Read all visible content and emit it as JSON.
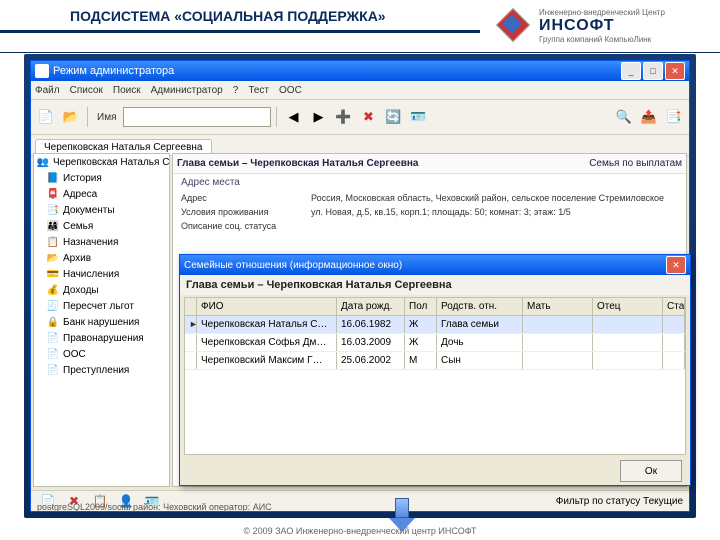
{
  "slide_title": "ПОДСИСТЕМА «СОЦИАЛЬНАЯ ПОДДЕРЖКА»",
  "logo": {
    "over": "Инженерно-внедренческий Центр",
    "name": "ИНСОФТ",
    "sub": "Группа компаний КомпьюЛинк"
  },
  "footer": "© 2009 ЗАО Инженерно-внедренческий центр ИНСОФТ",
  "app": {
    "title": "Режим администратора",
    "menus": [
      "Файл",
      "Список",
      "Поиск",
      "Администратор",
      "?",
      "Тест",
      "ООС"
    ],
    "toolbar_label_name": "Имя",
    "search_placeholder": "",
    "tab": "Черепковская Наталья Сергеевна",
    "tree": [
      {
        "ico": "👥",
        "lbl": "Черепковская Наталья Сергеевна",
        "lvl": 0
      },
      {
        "ico": "📘",
        "lbl": "История",
        "lvl": 1
      },
      {
        "ico": "📮",
        "lbl": "Адреса",
        "lvl": 1
      },
      {
        "ico": "📑",
        "lbl": "Документы",
        "lvl": 1
      },
      {
        "ico": "👨‍👩‍👧",
        "lbl": "Семья",
        "lvl": 1
      },
      {
        "ico": "📋",
        "lbl": "Назначения",
        "lvl": 1
      },
      {
        "ico": "📂",
        "lbl": "Архив",
        "lvl": 1
      },
      {
        "ico": "💳",
        "lbl": "Начисления",
        "lvl": 1
      },
      {
        "ico": "💰",
        "lbl": "Доходы",
        "lvl": 1
      },
      {
        "ico": "🧾",
        "lbl": "Пересчет льгот",
        "lvl": 1
      },
      {
        "ico": "🔒",
        "lbl": "Банк нарушения",
        "lvl": 1
      },
      {
        "ico": "📄",
        "lbl": "Правонарушения",
        "lvl": 1
      },
      {
        "ico": "📄",
        "lbl": "ООС",
        "lbl2": "",
        "lvl": 1
      },
      {
        "ico": "📄",
        "lbl": "Преступления",
        "lvl": 1
      }
    ],
    "content": {
      "heading_l": "Глава семьи – Черепковская Наталья Сергеевна",
      "heading_r": "Семья по выплатам",
      "sub": "Адрес места",
      "rows": [
        {
          "l": "Адрес",
          "r": "Россия, Московская область, Чеховский район, сельское поселение Стремиловское"
        },
        {
          "l": "Условия проживания",
          "r": "ул. Новая, д.5, кв.15, корп.1; площадь: 50; комнат: 3; этаж: 1/5"
        },
        {
          "l": "Описание соц. статуса",
          "r": ""
        }
      ]
    },
    "statusbar_left": "postgreSQL2009/social   район: Чеховский   оператор: АИС",
    "statusbar_right": "Фильтр по статусу   Текущие"
  },
  "modal": {
    "title": "Семейные отношения (информационное окно)",
    "heading": "Глава семьи – Черепковская Наталья Сергеевна",
    "columns": [
      "",
      "ФИО",
      "Дата рожд.",
      "Пол",
      "Родств. отн.",
      "Мать",
      "Отец",
      "Статус"
    ],
    "rows": [
      {
        "mark": "►",
        "fio": "Черепковская Наталья С…",
        "dob": "16.06.1982",
        "sex": "Ж",
        "rel": "Глава семьи",
        "mom": "",
        "dad": "",
        "st": ""
      },
      {
        "mark": "",
        "fio": "Черепковская Софья Дм…",
        "dob": "16.03.2009",
        "sex": "Ж",
        "rel": "Дочь",
        "mom": "",
        "dad": "",
        "st": ""
      },
      {
        "mark": "",
        "fio": "Черепковский Максим Г…",
        "dob": "25.06.2002",
        "sex": "М",
        "rel": "Сын",
        "mom": "",
        "dad": "",
        "st": ""
      }
    ],
    "ok": "Ок"
  }
}
